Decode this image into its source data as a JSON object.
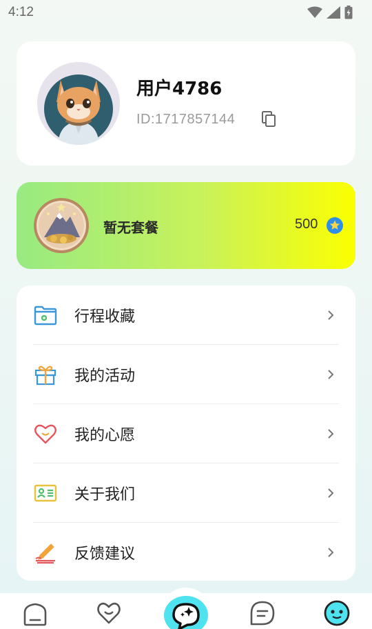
{
  "status_bar": {
    "time": "4:12"
  },
  "profile": {
    "username": "用户4786",
    "user_id": "ID:1717857144"
  },
  "plan": {
    "label": "暂无套餐",
    "coins": "500"
  },
  "menu": {
    "items": [
      {
        "label": "行程收藏",
        "icon": "folder-icon"
      },
      {
        "label": "我的活动",
        "icon": "gift-icon"
      },
      {
        "label": "我的心愿",
        "icon": "heart-icon"
      },
      {
        "label": "关于我们",
        "icon": "id-card-icon"
      },
      {
        "label": "反馈建议",
        "icon": "pen-icon"
      }
    ]
  },
  "tab_bar": {
    "tabs": [
      {
        "icon": "home-icon"
      },
      {
        "icon": "heart-icon"
      },
      {
        "icon": "chat-bubble-sparkle-icon"
      },
      {
        "icon": "message-icon"
      },
      {
        "icon": "profile-face-icon",
        "active": true
      }
    ]
  },
  "colors": {
    "accent_cyan": "#4fe3f0",
    "plan_gradient_start": "#97ea82",
    "plan_gradient_end": "#fbff00",
    "coin_blue": "#2f8fe6"
  }
}
